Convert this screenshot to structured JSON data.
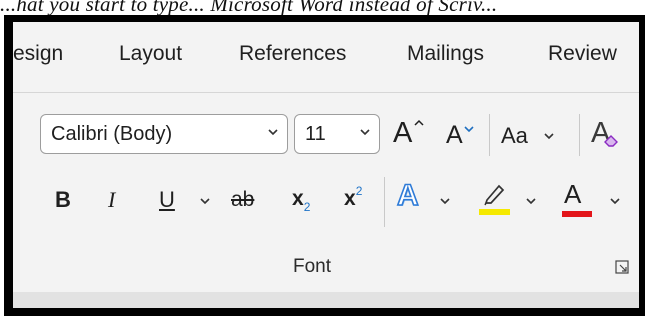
{
  "top_text": "...hat you start to type... Microsoft Word instead of Scriv...",
  "tabs": [
    "esign",
    "Layout",
    "References",
    "Mailings",
    "Review"
  ],
  "font": {
    "name": "Calibri (Body)",
    "size": "11"
  },
  "buttons": {
    "grow_font": "A",
    "shrink_font": "A",
    "change_case": "Aa",
    "clear_formatting": "A",
    "bold": "B",
    "italic": "I",
    "underline": "U",
    "strikethrough": "ab",
    "subscript_base": "x",
    "subscript_mark": "2",
    "superscript_base": "x",
    "superscript_mark": "2",
    "text_effects": "A",
    "font_color": "A"
  },
  "group_label": "Font",
  "colors": {
    "highlight": "#f5e900",
    "font_color": "#e3151a",
    "text_effects": "#2f7bd7",
    "accent_blue": "#1e73c8"
  },
  "icons": [
    "chevron-down-icon",
    "highlighter-icon",
    "clear-formatting-eraser-icon",
    "dialog-launcher-icon"
  ]
}
